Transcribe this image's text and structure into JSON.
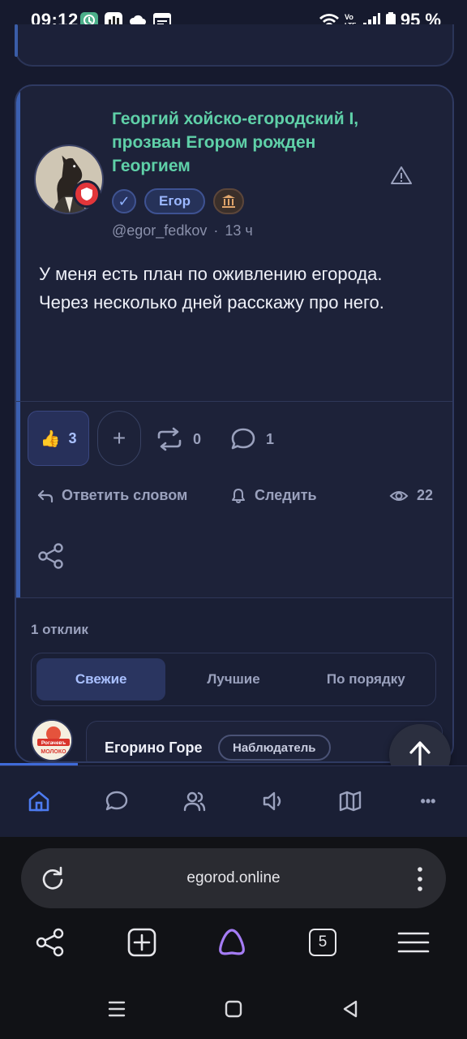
{
  "status_bar": {
    "time": "09:12",
    "battery": "95 %",
    "volte_label": "Vo LTE"
  },
  "post": {
    "author_name": "Георгий хойско-егородский I, прозван Егором рожден Георгием",
    "verified_mark": "✓",
    "role_badge": "Егор",
    "username": "@egor_fedkov",
    "time_ago": "13 ч",
    "meta_separator": "·",
    "text": "У меня есть план по оживлению егорода. Через несколько дней расскажу про него.",
    "reactions": {
      "like_emoji": "👍",
      "like_count": "3",
      "add_reaction": "+",
      "reposts": "0",
      "comments": "1"
    },
    "actions": {
      "reply": "Ответить словом",
      "follow": "Следить",
      "views": "22"
    }
  },
  "comments": {
    "count_label": "1 отклик",
    "sort_tabs": [
      {
        "label": "Свежие",
        "active": true
      },
      {
        "label": "Лучшие",
        "active": false
      },
      {
        "label": "По порядку",
        "active": false
      }
    ],
    "first_comment": {
      "author": "Егорино Горе",
      "role": "Наблюдатель",
      "avatar_text_top": "Рогачевъ",
      "avatar_text_bottom": "МОЛОКО"
    }
  },
  "app_nav": {
    "items": [
      "home-icon",
      "chat-icon",
      "users-icon",
      "announce-icon",
      "map-icon",
      "more-icon"
    ],
    "more_label": "•••"
  },
  "browser": {
    "url": "egorod.online",
    "tab_count": "5"
  },
  "colors": {
    "background": "#161a2e",
    "card": "#1d2239",
    "author_green": "#5fd0a8",
    "accent_blue": "#3b5fb0",
    "badge_red": "#e2363a"
  }
}
